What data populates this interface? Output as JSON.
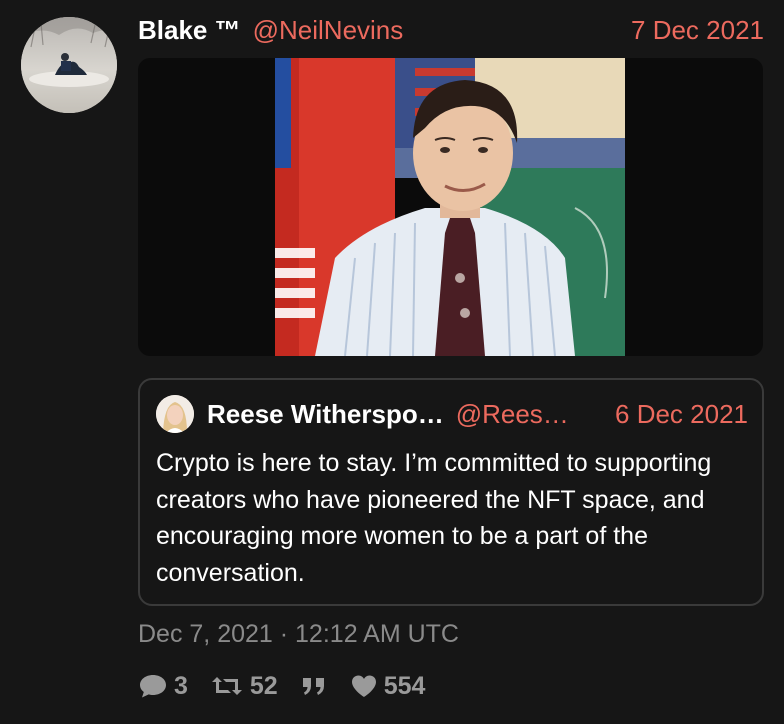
{
  "tweet": {
    "display_name": "Blake ™",
    "handle": "@NeilNevins",
    "date": "7 Dec 2021",
    "timestamp": "Dec 7, 2021 · 12:12 AM UTC"
  },
  "quote": {
    "display_name": "Reese Witherspo…",
    "handle": "@Rees…",
    "date": "6 Dec 2021",
    "text": "Crypto is here to stay. I’m committed to supporting creators who have pioneered the NFT space, and encouraging more women to be a part of the conversation."
  },
  "stats": {
    "replies": "3",
    "retweets": "52",
    "likes": "554"
  },
  "icons": {
    "reply": "comment-icon",
    "retweet": "retweet-icon",
    "quote": "quote-icon",
    "like": "heart-icon"
  },
  "colors": {
    "background": "#161616",
    "accent": "#ec6a5e",
    "muted": "#8a8a8a"
  }
}
